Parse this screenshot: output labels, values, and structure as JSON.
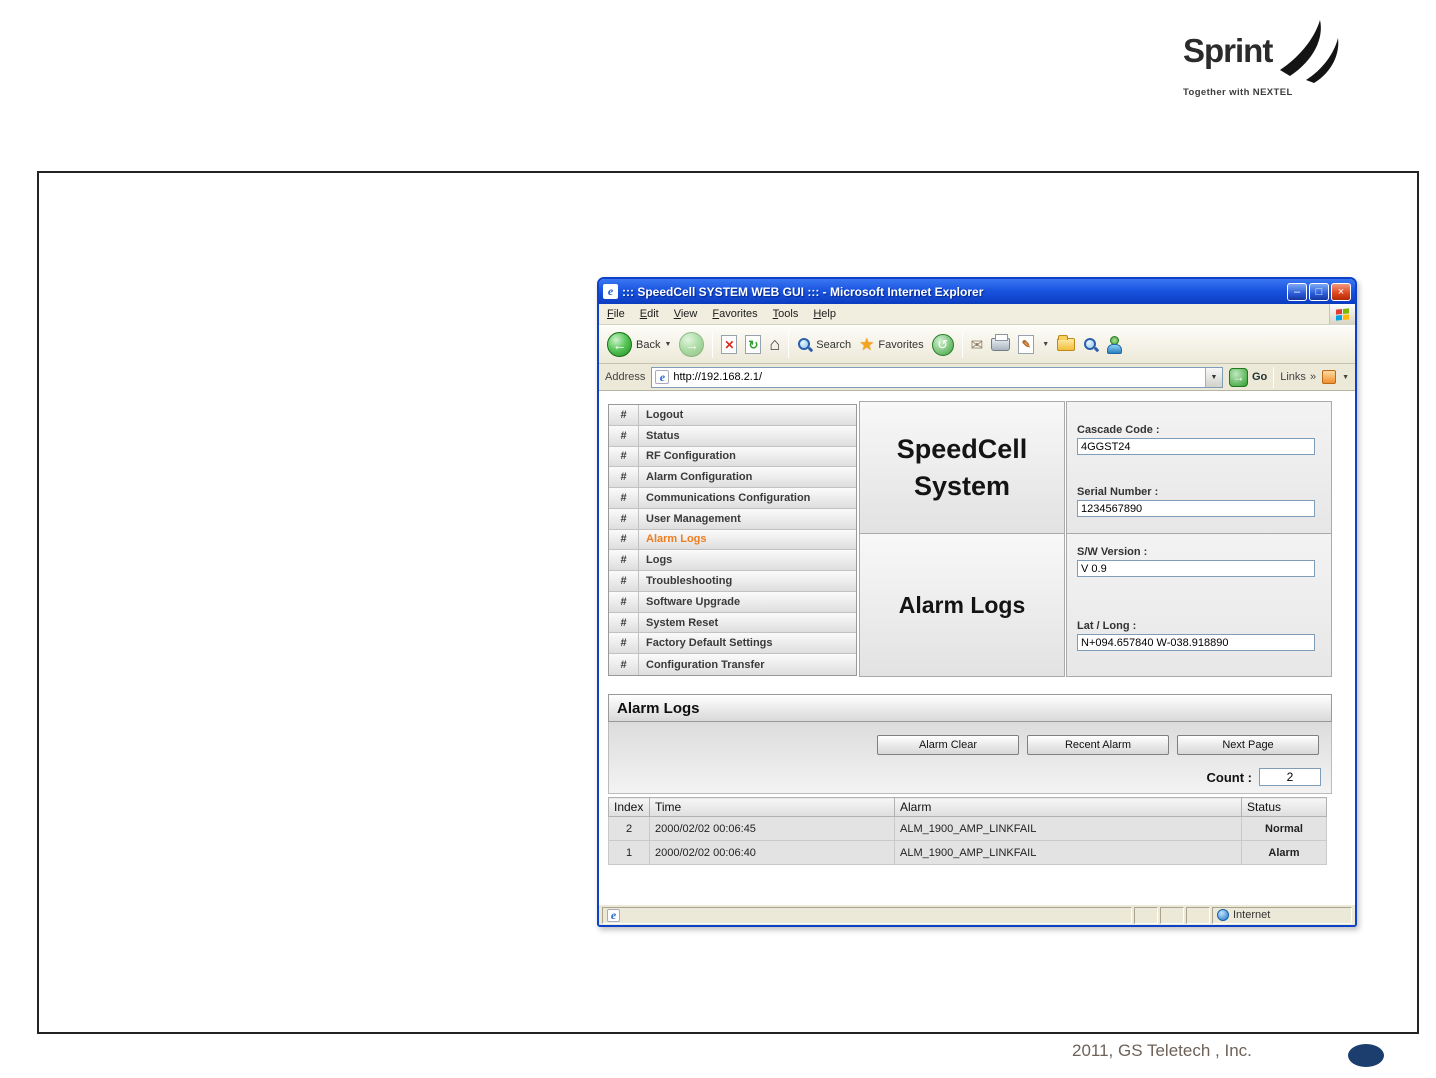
{
  "logo": {
    "brand": "Sprint",
    "tagline": "Together with NEXTEL"
  },
  "slide": {
    "footer": "2011, GS Teletech , Inc."
  },
  "browser": {
    "title": "::: SpeedCell SYSTEM WEB GUI ::: - Microsoft Internet Explorer",
    "menus": [
      "File",
      "Edit",
      "View",
      "Favorites",
      "Tools",
      "Help"
    ],
    "toolbar": {
      "back_label": "Back",
      "search_label": "Search",
      "favorites_label": "Favorites"
    },
    "address": {
      "label": "Address",
      "url": "http://192.168.2.1/",
      "go_label": "Go",
      "links_label": "Links"
    },
    "status": {
      "zone": "Internet"
    }
  },
  "icons": {
    "back": "←",
    "forward": "→",
    "stop": "✕",
    "refresh": "↻",
    "home": "⌂",
    "star": "★",
    "history": "↺",
    "mail": "✉",
    "edit": "✎",
    "minimize": "–",
    "maximize": "□",
    "close": "×",
    "dropdown": "▼",
    "links_chevron": "»",
    "go_arrow": "→",
    "ie": "e"
  },
  "page": {
    "menu_bullet": "#",
    "menu_items": [
      "Logout",
      "Status",
      "RF Configuration",
      "Alarm Configuration",
      "Communications Configuration",
      "User Management",
      "Alarm Logs",
      "Logs",
      "Troubleshooting",
      "Software Upgrade",
      "System Reset",
      "Factory Default Settings",
      "Configuration Transfer"
    ],
    "active_menu": "Alarm Logs",
    "system_title": "SpeedCell System",
    "page_title": "Alarm Logs",
    "fields": [
      {
        "label": "Cascade Code :",
        "value": "4GGST24"
      },
      {
        "label": "Serial Number :",
        "value": "1234567890"
      },
      {
        "label": "S/W Version :",
        "value": "V 0.9"
      },
      {
        "label": "Lat / Long :",
        "value": "N+094.657840 W-038.918890"
      }
    ],
    "section_title": "Alarm Logs",
    "buttons": [
      "Alarm Clear",
      "Recent Alarm",
      "Next Page"
    ],
    "count_label": "Count :",
    "count_value": "2",
    "table": {
      "headers": [
        "Index",
        "Time",
        "Alarm",
        "Status"
      ],
      "rows": [
        {
          "index": "2",
          "time": "2000/02/02 00:06:45",
          "alarm": "ALM_1900_AMP_LINKFAIL",
          "status": "Normal"
        },
        {
          "index": "1",
          "time": "2000/02/02 00:06:40",
          "alarm": "ALM_1900_AMP_LINKFAIL",
          "status": "Alarm"
        }
      ]
    },
    "colors": {
      "status_normal": "#2eb82e",
      "status_alarm": "#ff5566",
      "active_menu": "#ef7d1f",
      "titlebar_blue": "#1a55e0"
    }
  }
}
